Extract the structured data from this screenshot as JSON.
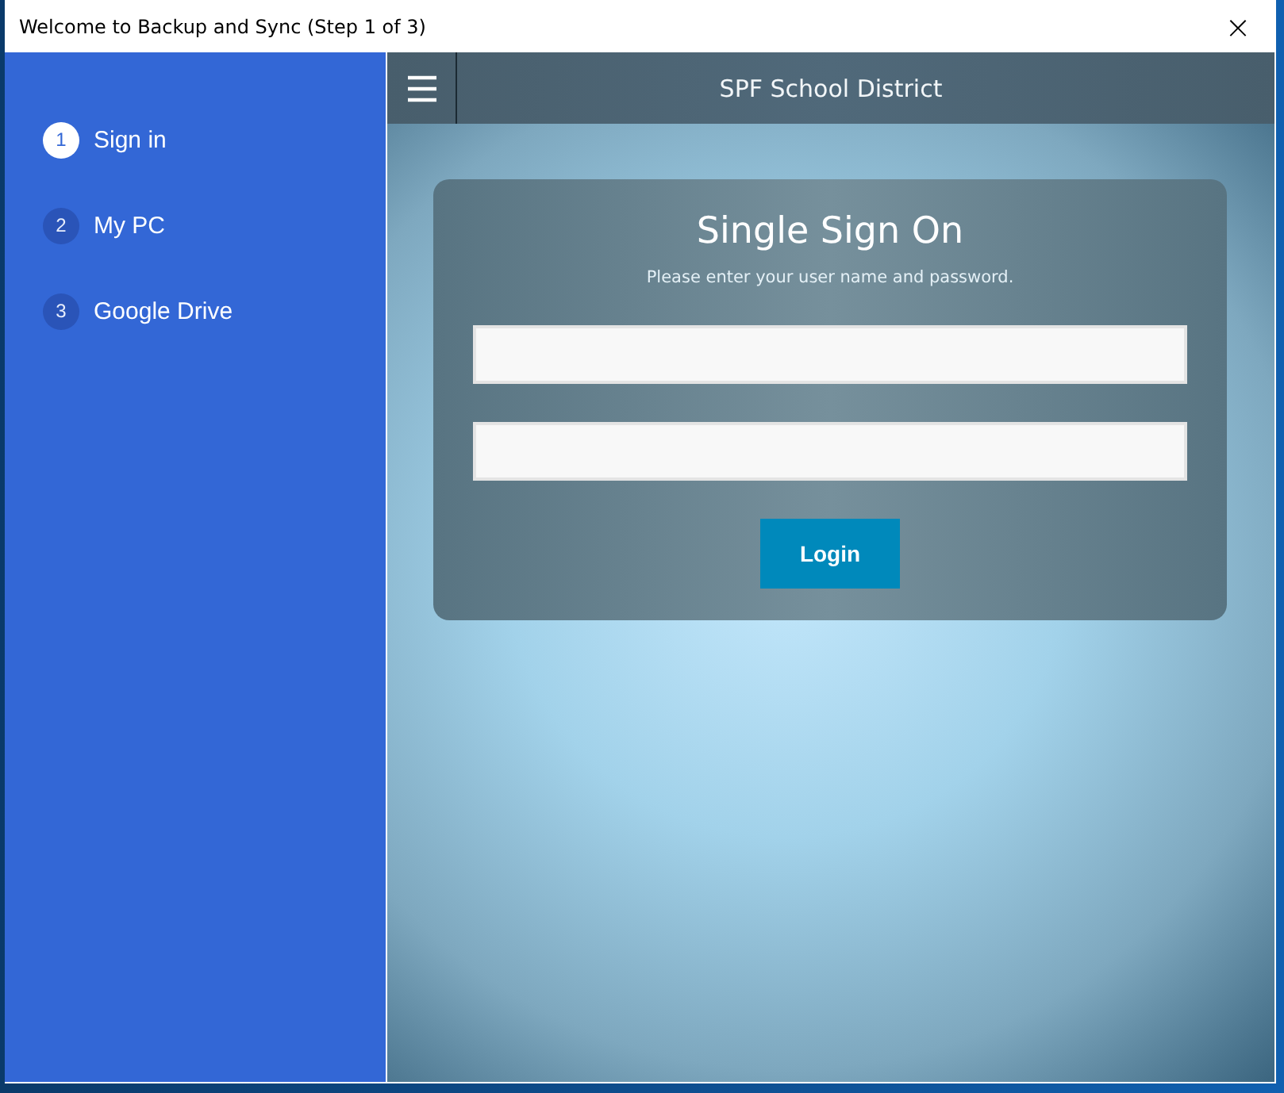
{
  "window": {
    "title": "Welcome to Backup and Sync (Step 1 of 3)",
    "close": "×"
  },
  "steps": [
    {
      "number": "1",
      "label": "Sign in",
      "selected": true
    },
    {
      "number": "2",
      "label": "My PC",
      "selected": false
    },
    {
      "number": "3",
      "label": "Google Drive",
      "selected": false
    }
  ],
  "portal": {
    "header_title": "SPF School District",
    "heading": "Single Sign On",
    "instructions": "Please enter your user name and password.",
    "button": "Login"
  }
}
